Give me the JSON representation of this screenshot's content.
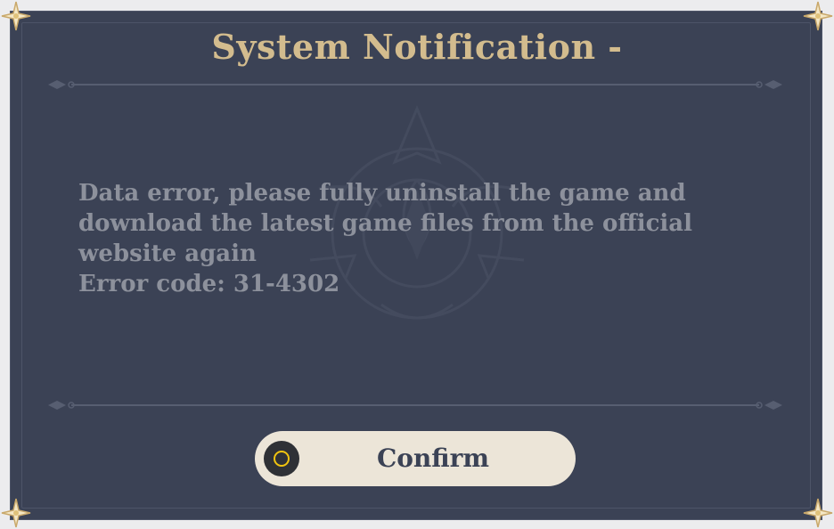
{
  "dialog": {
    "title": "System Notification -",
    "message_lines": [
      "Data error, please fully uninstall the game and",
      "download the latest game files from the official",
      "website again",
      "Error code: 31-4302"
    ]
  },
  "confirm_button": {
    "label": "Confirm",
    "icon": "circle-confirm-icon"
  },
  "colors": {
    "panel_background": "#3b4255",
    "title_gold": "#d3bc8e",
    "message_gray": "#8d919c",
    "button_background": "#ece5d8",
    "button_icon_ring": "#f1c40f"
  }
}
